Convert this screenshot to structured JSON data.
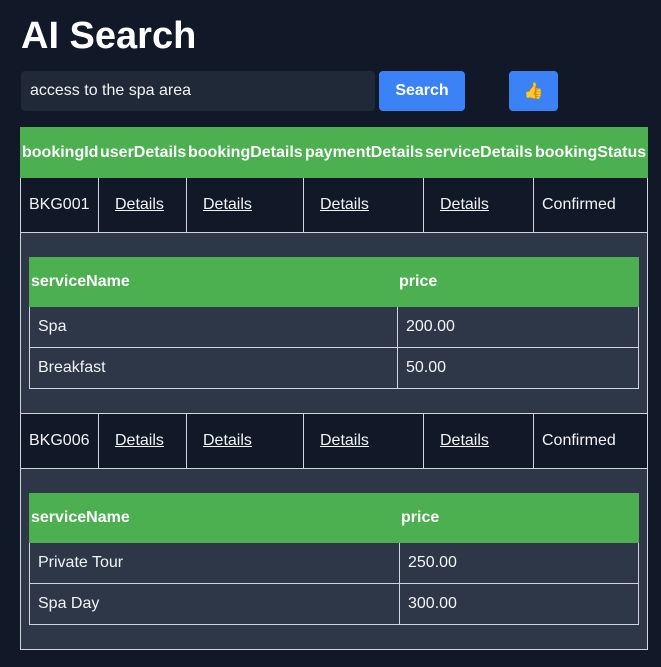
{
  "app": {
    "title": "AI Search"
  },
  "search": {
    "value": "access to the spa area",
    "placeholder": "",
    "button_label": "Search",
    "thumb_icon": "👍"
  },
  "table": {
    "columns": [
      "bookingId",
      "userDetails",
      "bookingDetails",
      "paymentDetails",
      "serviceDetails",
      "bookingStatus"
    ],
    "rows": [
      {
        "bookingId": "BKG001",
        "userDetails": "Details",
        "bookingDetails": "Details",
        "paymentDetails": "Details",
        "serviceDetails": "Details",
        "bookingStatus": "Confirmed",
        "services": {
          "columns": [
            "serviceName",
            "price"
          ],
          "items": [
            {
              "serviceName": "Spa",
              "price": "200.00"
            },
            {
              "serviceName": "Breakfast",
              "price": "50.00"
            }
          ]
        }
      },
      {
        "bookingId": "BKG006",
        "userDetails": "Details",
        "bookingDetails": "Details",
        "paymentDetails": "Details",
        "serviceDetails": "Details",
        "bookingStatus": "Confirmed",
        "services": {
          "columns": [
            "serviceName",
            "price"
          ],
          "items": [
            {
              "serviceName": "Private Tour",
              "price": "250.00"
            },
            {
              "serviceName": "Spa Day",
              "price": "300.00"
            }
          ]
        }
      }
    ]
  },
  "colors": {
    "background": "#111827",
    "header_green": "#4caf50",
    "button_blue": "#3b82f6",
    "nested_panel": "#2d3748"
  }
}
